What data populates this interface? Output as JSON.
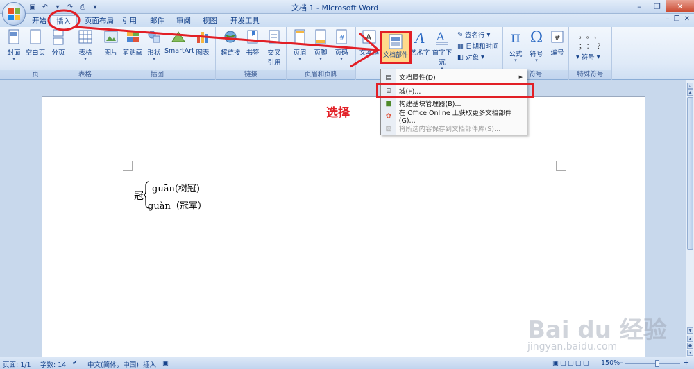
{
  "window": {
    "title": "文档 1 - Microsoft Word",
    "controls": [
      "–",
      "❐",
      "✕"
    ]
  },
  "tabs": [
    {
      "label": "开始"
    },
    {
      "label": "插入"
    },
    {
      "label": "页面布局"
    },
    {
      "label": "引用"
    },
    {
      "label": "邮件"
    },
    {
      "label": "审阅"
    },
    {
      "label": "视图"
    },
    {
      "label": "开发工具"
    }
  ],
  "ribbon": {
    "groups": {
      "page": {
        "label": "页",
        "buttons": [
          "封面",
          "空白页",
          "分页"
        ]
      },
      "table": {
        "label": "表格",
        "buttons": [
          "表格"
        ]
      },
      "illustrations": {
        "label": "插图",
        "buttons": [
          "图片",
          "剪贴画",
          "形状",
          "SmartArt",
          "图表"
        ]
      },
      "links": {
        "label": "链接",
        "buttons": [
          "超链接",
          "书签",
          "交叉",
          "引用"
        ]
      },
      "header_footer": {
        "label": "页眉和页脚",
        "buttons": [
          "页眉",
          "页脚",
          "页码"
        ]
      },
      "text": {
        "buttons": [
          "文本框",
          "文档部件",
          "艺术字",
          "首字下沉"
        ],
        "small_buttons": [
          "签名行",
          "日期和时间",
          "对象"
        ]
      },
      "symbols": {
        "label": "符号",
        "buttons": [
          "公式",
          "符号",
          "编号"
        ]
      },
      "special": {
        "label": "特殊符号",
        "small_buttons": [
          "符号"
        ]
      }
    }
  },
  "menu": {
    "items": [
      {
        "label": "文档属性(D)"
      },
      {
        "label": "域(F)..."
      },
      {
        "label": "构建基块管理器(B)..."
      },
      {
        "label": "在 Office Online 上获取更多文档部件(G)..."
      },
      {
        "label": "将所选内容保存到文档部件库(S)..."
      }
    ]
  },
  "document": {
    "char": "冠",
    "line1": "guān(树冠)",
    "line2": "guàn（冠军）"
  },
  "annotation": {
    "text": "选择",
    "color": "#e21f26"
  },
  "statusbar": {
    "page": "页面: 1/1",
    "words": "字数: 14",
    "language": "中文(简体，中国)",
    "mode": "插入",
    "zoom": "150%"
  },
  "watermark": {
    "main": "Bai du 经验",
    "sub": "jingyan.baidu.com"
  },
  "colors": {
    "accent": "#15428b",
    "highlight": "#ffd98a",
    "red": "#e21f26"
  }
}
